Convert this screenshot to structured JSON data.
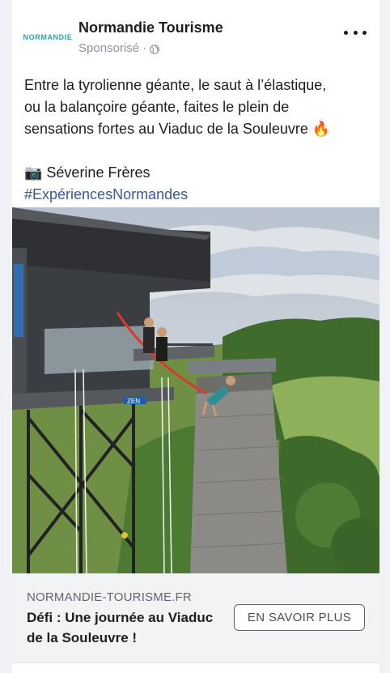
{
  "post": {
    "avatar_logo_text": "NORMANDIE",
    "page_name": "Normandie Tourisme",
    "sponsored_label": "Sponsorisé ·",
    "more_icon": "more-horizontal-icon",
    "globe_icon": "globe-icon"
  },
  "text": {
    "line1": "Entre la tyrolienne géante, le saut à l’élastique,",
    "line2": "ou la balançoire géante, faites le plein de",
    "line3": "sensations fortes au Viaduc de la Souleuvre 🔥",
    "credit": "📷 Séverine Frères",
    "hashtag": "#ExpériencesNormandes"
  },
  "link_preview": {
    "domain": "NORMANDIE-TOURISME.FR",
    "headline": "Défi : Une journée au Viaduc de la Souleuvre !",
    "cta_label": "EN SAVOIR PLUS"
  },
  "photo": {
    "sign_text": "ZEN"
  },
  "colors": {
    "link": "#385898",
    "logo": "#2aa8a0",
    "background": "#f0f2f5",
    "cta_bar": "#f2f3f5"
  }
}
